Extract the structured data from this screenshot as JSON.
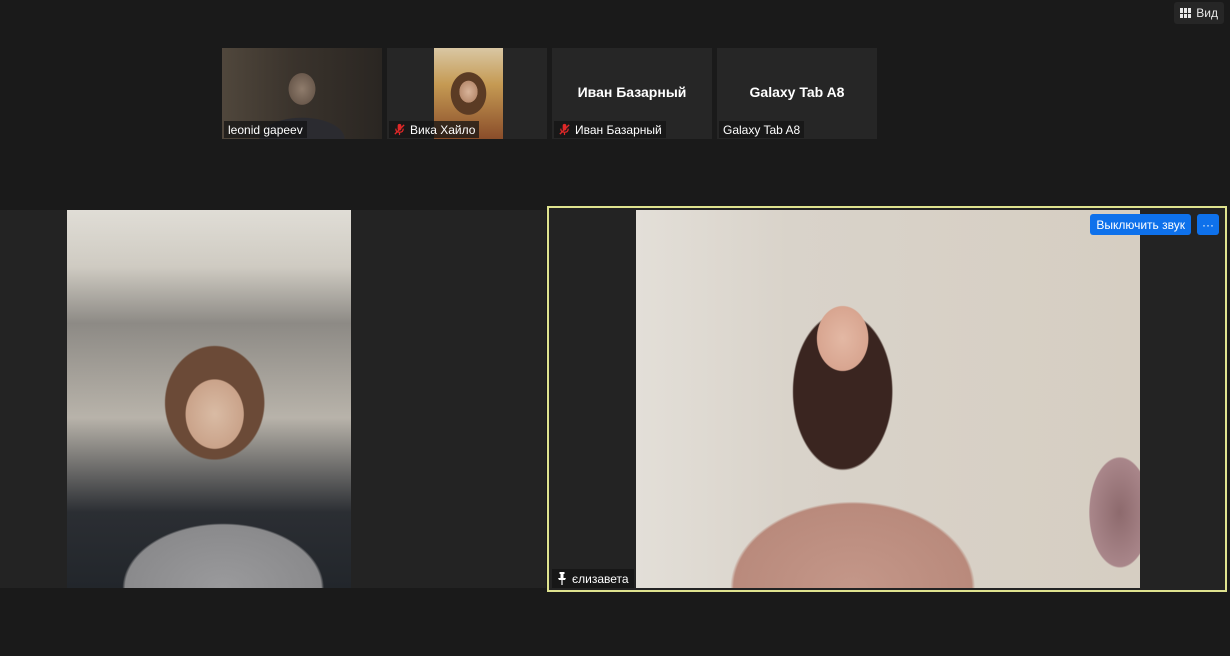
{
  "toolbar": {
    "view_label": "Вид"
  },
  "thumbnails": [
    {
      "name": "leonid gapeev",
      "muted": false,
      "has_video": true
    },
    {
      "name": "Вика Хайло",
      "muted": true,
      "has_video": true
    },
    {
      "name": "Иван Базарный",
      "center_name": "Иван Базарный",
      "muted": true,
      "has_video": false
    },
    {
      "name": "Galaxy Tab A8",
      "center_name": "Galaxy Tab A8",
      "muted": false,
      "has_video": false
    }
  ],
  "active_speaker": {
    "name": "єлизавета",
    "mute_button_label": "Выключить звук",
    "more_button_label": "···",
    "highlight_color": "#dfe38f"
  },
  "colors": {
    "accent": "#0e71eb",
    "muted": "#e02828",
    "background": "#1a1a1a"
  },
  "icons": [
    "grid-view-icon",
    "muted-mic-icon",
    "pin-icon"
  ]
}
